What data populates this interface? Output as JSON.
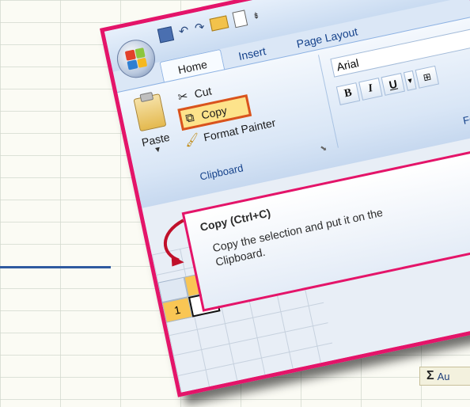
{
  "quick_access": {
    "icons": [
      "save-icon",
      "undo-icon",
      "redo-icon",
      "open-folder-icon",
      "new-document-icon",
      "customize-icon"
    ]
  },
  "tabs": [
    {
      "label": "Home"
    },
    {
      "label": "Insert"
    },
    {
      "label": "Page Layout"
    }
  ],
  "clipboard_group": {
    "paste_label": "Paste",
    "cut_label": "Cut",
    "copy_label": "Copy",
    "format_painter_label": "Format Painter",
    "group_label": "Clipboard"
  },
  "font_group": {
    "font_name": "Arial",
    "bold": "B",
    "italic": "I",
    "underline": "U",
    "group_label": "Font"
  },
  "tooltip": {
    "title": "Copy (Ctrl+C)",
    "description": "Copy the selection and put it on the Clipboard."
  },
  "sheet": {
    "row_label": "1"
  },
  "background": {
    "autosum_label": "Au"
  },
  "colors": {
    "highlight_border": "#e41469",
    "copy_highlight": "#fde38b",
    "copy_border": "#d9531e",
    "arrow": "#c0102a"
  }
}
